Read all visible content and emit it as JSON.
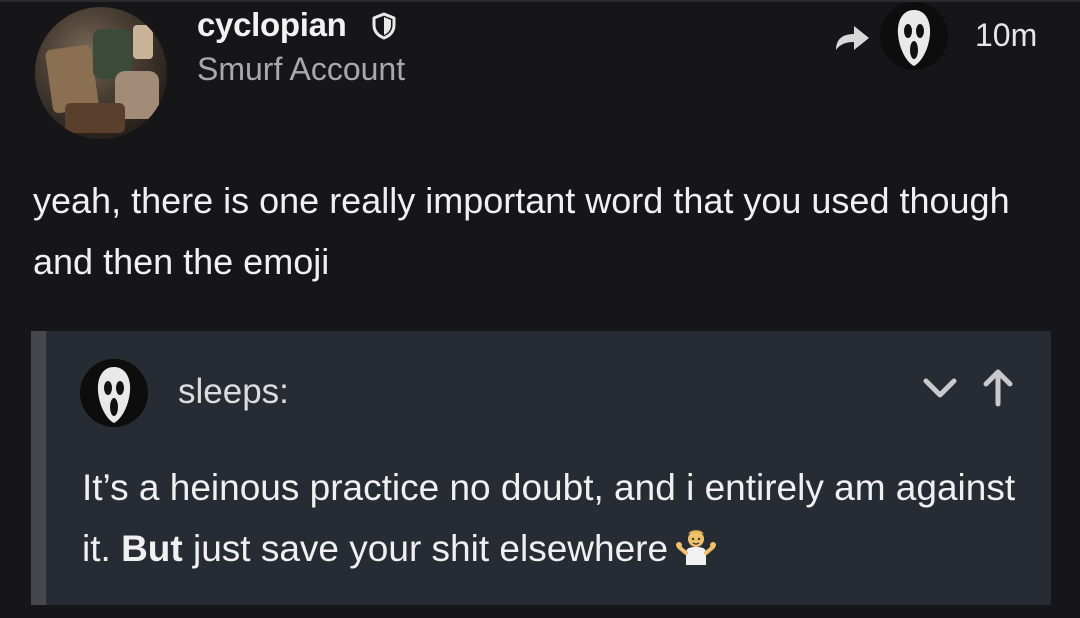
{
  "comment": {
    "author": {
      "username": "cyclopian",
      "subtitle": "Smurf Account",
      "badge_icon": "shield-icon"
    },
    "reply_to_icon": "share-icon",
    "reply_to_avatar": "scream-ghost-avatar",
    "timestamp": "10m",
    "body": "yeah, there is one really important word that you used though and then the emoji"
  },
  "quote": {
    "author": "sleeps:",
    "avatar": "scream-ghost-avatar",
    "icons": [
      "chevron-down-icon",
      "arrow-up-icon"
    ],
    "text_before_bold": "It’s a heinous practice no doubt, and i entirely am against it. ",
    "text_bold": "But",
    "text_after_bold": " just save your shit elsewhere",
    "emoji": "person-shrugging-emoji"
  },
  "colors": {
    "background": "#161618",
    "quote_background": "#272b33",
    "quote_bar": "#45474c",
    "primary_text": "#f0f0f0",
    "secondary_text": "#a9a9ab"
  }
}
